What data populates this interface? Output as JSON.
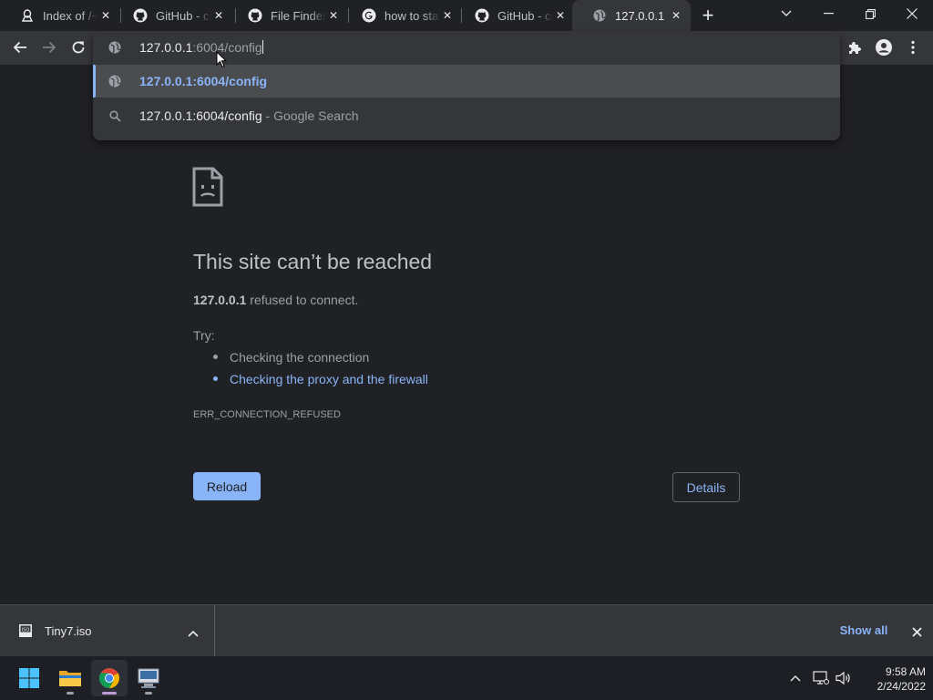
{
  "browser": {
    "tabs": [
      {
        "title": "Index of /~",
        "icon": "folder-linux-icon",
        "active": false
      },
      {
        "title": "GitHub - co",
        "icon": "github-icon",
        "active": false
      },
      {
        "title": "File Finder",
        "icon": "github-icon",
        "active": false
      },
      {
        "title": "how to star",
        "icon": "google-icon",
        "active": false
      },
      {
        "title": "GitHub - co",
        "icon": "github-icon",
        "active": false
      },
      {
        "title": "127.0.0.1",
        "icon": "globe-icon",
        "active": true
      }
    ],
    "new_tab_label": "+",
    "omnibox": {
      "host": "127.0.0.1",
      "path": ":6004/config",
      "suggestions": [
        {
          "text": "127.0.0.1:6004/config",
          "suffix": "",
          "icon": "globe-icon",
          "selected": true
        },
        {
          "text": "127.0.0.1:6004/config",
          "suffix": " - Google Search",
          "icon": "search-icon",
          "selected": false
        }
      ]
    }
  },
  "error_page": {
    "title": "This site can’t be reached",
    "host": "127.0.0.1",
    "desc_rest": " refused to connect.",
    "try_label": "Try:",
    "suggestions": [
      "Checking the connection",
      "Checking the proxy and the firewall"
    ],
    "error_code": "ERR_CONNECTION_REFUSED",
    "reload_label": "Reload",
    "details_label": "Details"
  },
  "download_bar": {
    "file_name": "Tiny7.iso",
    "show_all_label": "Show all"
  },
  "taskbar": {
    "apps": [
      "windows-start-icon",
      "file-explorer-icon",
      "chrome-icon",
      "network-config-icon"
    ],
    "time": "9:58 AM",
    "date": "2/24/2022"
  },
  "colors": {
    "accent": "#8ab4f8",
    "background": "#202124",
    "toolbar": "#35363a"
  }
}
